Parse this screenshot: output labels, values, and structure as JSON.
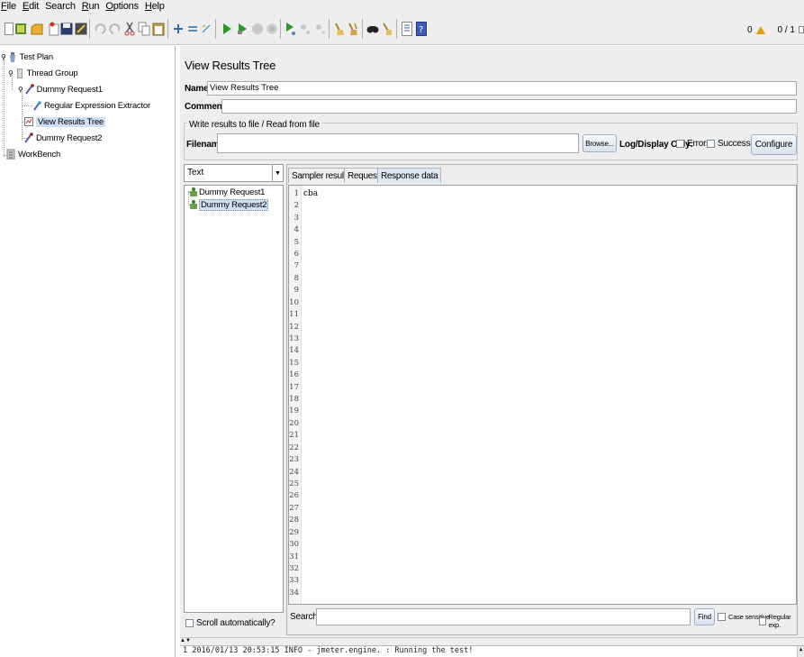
{
  "menu": [
    {
      "u": "F",
      "rest": "ile"
    },
    {
      "u": "E",
      "rest": "dit"
    },
    {
      "u": "",
      "rest": "Search"
    },
    {
      "u": "R",
      "rest": "un"
    },
    {
      "u": "O",
      "rest": "ptions"
    },
    {
      "u": "H",
      "rest": "elp"
    }
  ],
  "toolbar": {
    "warning_count": "0",
    "threads": "0 / 1"
  },
  "tree": {
    "test_plan": "Test Plan",
    "thread_group": "Thread Group",
    "dummy_request_1": "Dummy Request1",
    "regex_extractor": "Regular Expression Extractor",
    "view_results_tree": "View Results Tree",
    "dummy_request_2": "Dummy Request2",
    "workbench": "WorkBench"
  },
  "panel": {
    "title": "View Results Tree",
    "name_label": "Name:",
    "name_value": "View Results Tree",
    "comments_label": "Comments:",
    "comments_value": "",
    "file_group_title": "Write results to file / Read from file",
    "filename_label": "Filename",
    "filename_value": "",
    "browse_label": "Browse...",
    "log_display_label": "Log/Display Only:",
    "errors_label": "Errors",
    "successes_label": "Successes",
    "configure_label": "Configure"
  },
  "results": {
    "renderer": "Text",
    "items": [
      "Dummy Request1",
      "Dummy Request2"
    ],
    "scroll_label": "Scroll automatically?"
  },
  "tabs": [
    "Sampler result",
    "Request",
    "Response data"
  ],
  "response": {
    "lines": [
      "cba"
    ],
    "line_numbers": [
      "1",
      "2",
      "3",
      "4",
      "5",
      "6",
      "7",
      "8",
      "9",
      "10",
      "11",
      "12",
      "13",
      "14",
      "15",
      "16",
      "17",
      "18",
      "19",
      "20",
      "21",
      "22",
      "23",
      "24",
      "25",
      "26",
      "27",
      "28",
      "29",
      "30",
      "31",
      "32",
      "33",
      "34"
    ]
  },
  "search": {
    "label": "Search:",
    "value": "",
    "find_label": "Find",
    "case_label": "Case sensitive",
    "regex_label": "Regular exp."
  },
  "log": {
    "line": "1 2016/01/13 20:53:15 INFO  - jmeter.engine.              : Running the test!"
  }
}
